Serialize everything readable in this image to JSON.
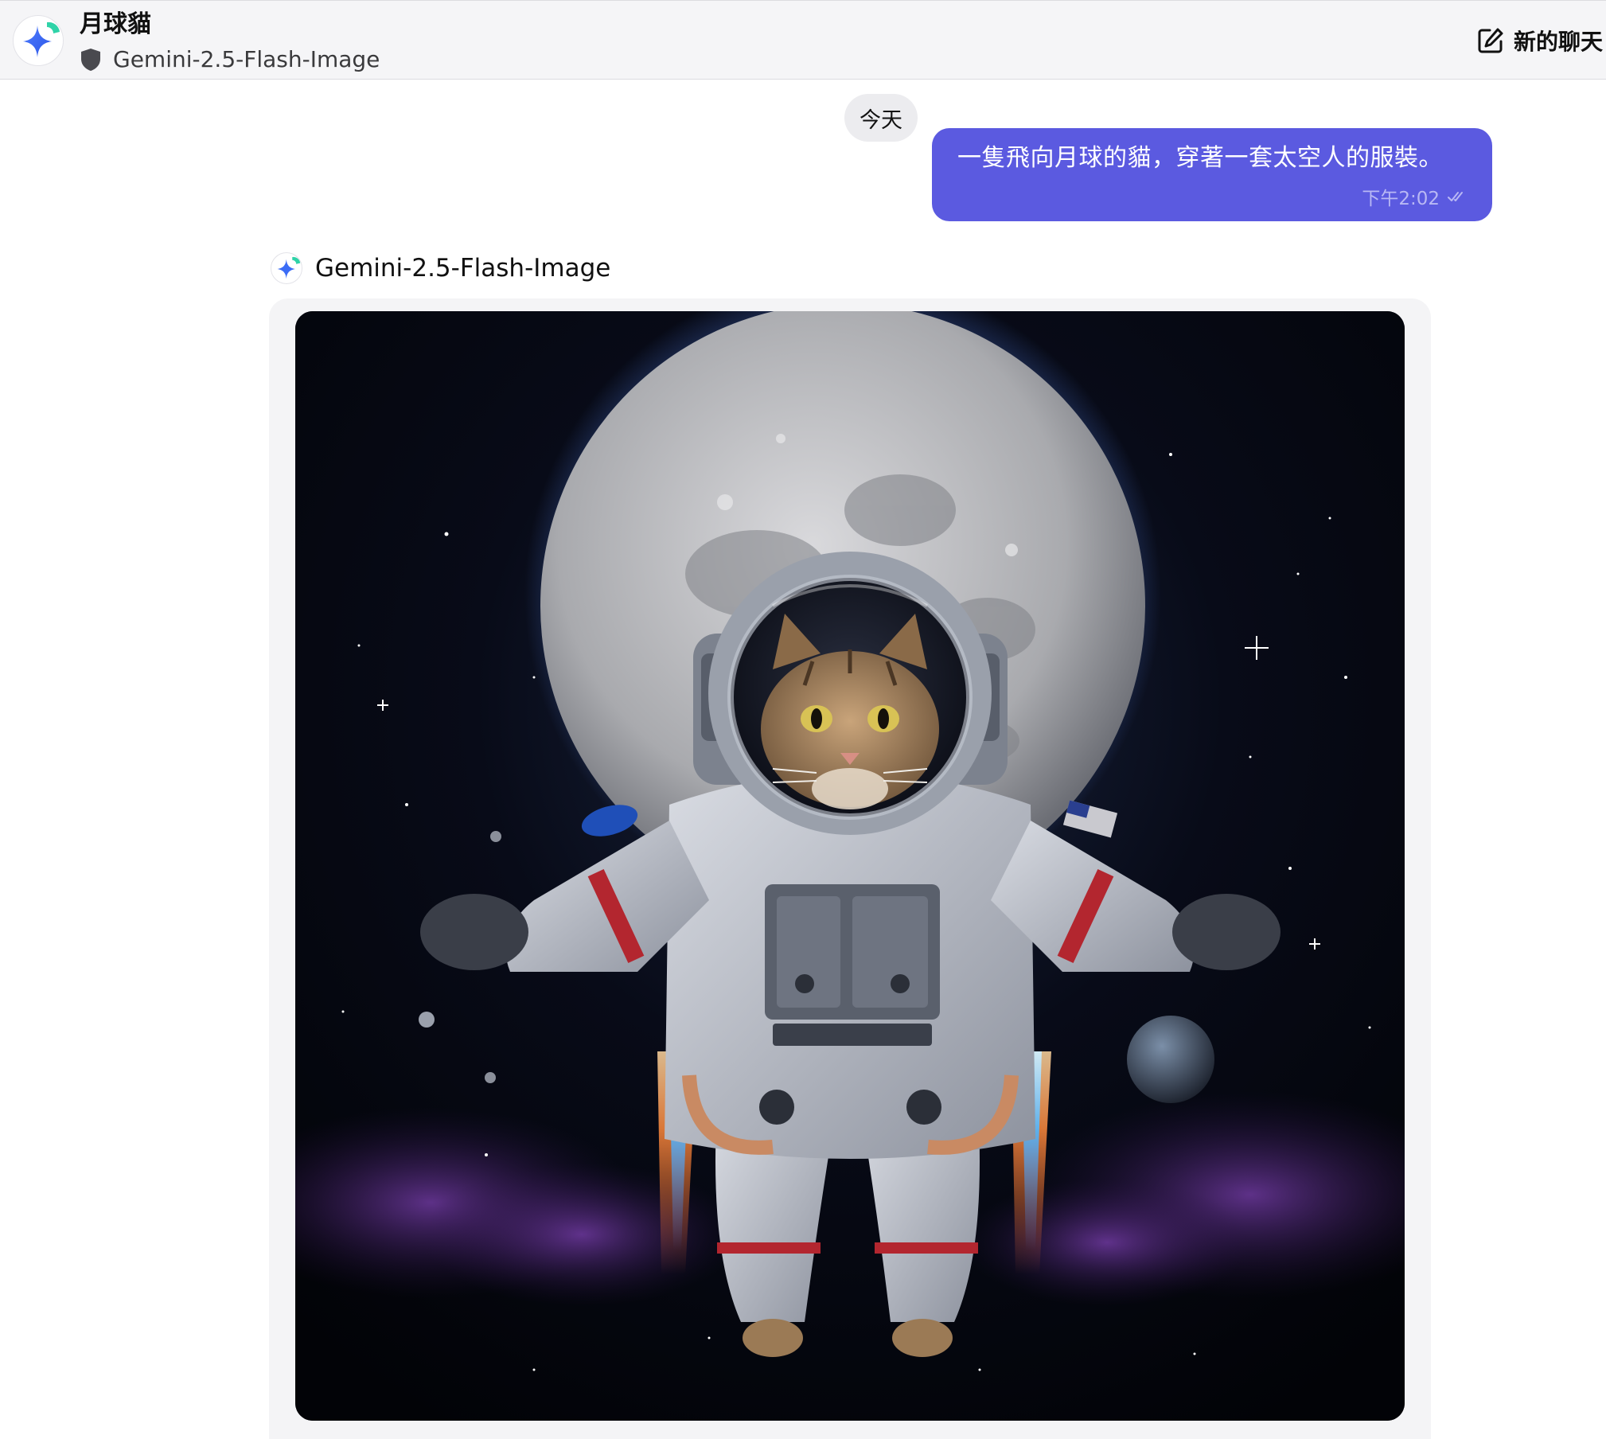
{
  "header": {
    "bot_name": "月球貓",
    "bot_model": "Gemini-2.5-Flash-Image",
    "new_chat_label": "新的聊天",
    "avatar_icon": "gemini-sparkle-icon",
    "badge_icon": "shield-icon",
    "new_chat_icon": "compose-icon"
  },
  "chat": {
    "date_label": "今天",
    "user_message": {
      "text": "一隻飛向月球的貓，穿著一套太空人的服裝。",
      "time": "下午2:02",
      "status_icon": "double-check-icon"
    },
    "bot_reply": {
      "model_name": "Gemini-2.5-Flash-Image",
      "image_icon": "generated-image-cat-astronaut"
    }
  },
  "colors": {
    "user_bubble": "#5b5ae0",
    "header_bg": "#f5f5f7",
    "accent_teal": "#2fd3a8",
    "sparkle_blue": "#3b6cf6"
  }
}
